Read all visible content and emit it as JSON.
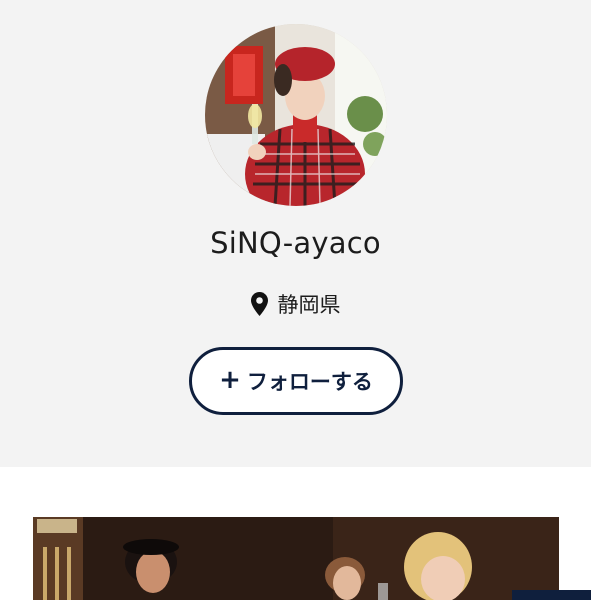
{
  "profile": {
    "username": "SiNQ-ayaco",
    "location": "静岡県",
    "location_icon": "map-pin-icon",
    "avatar": "profile-photo"
  },
  "actions": {
    "follow_plus": "+",
    "follow_label": "フォローする"
  },
  "feed": {
    "first_photo": "post-photo"
  },
  "colors": {
    "background": "#f3f3f3",
    "accent": "#0f1f3d",
    "text": "#1c1c1c"
  }
}
